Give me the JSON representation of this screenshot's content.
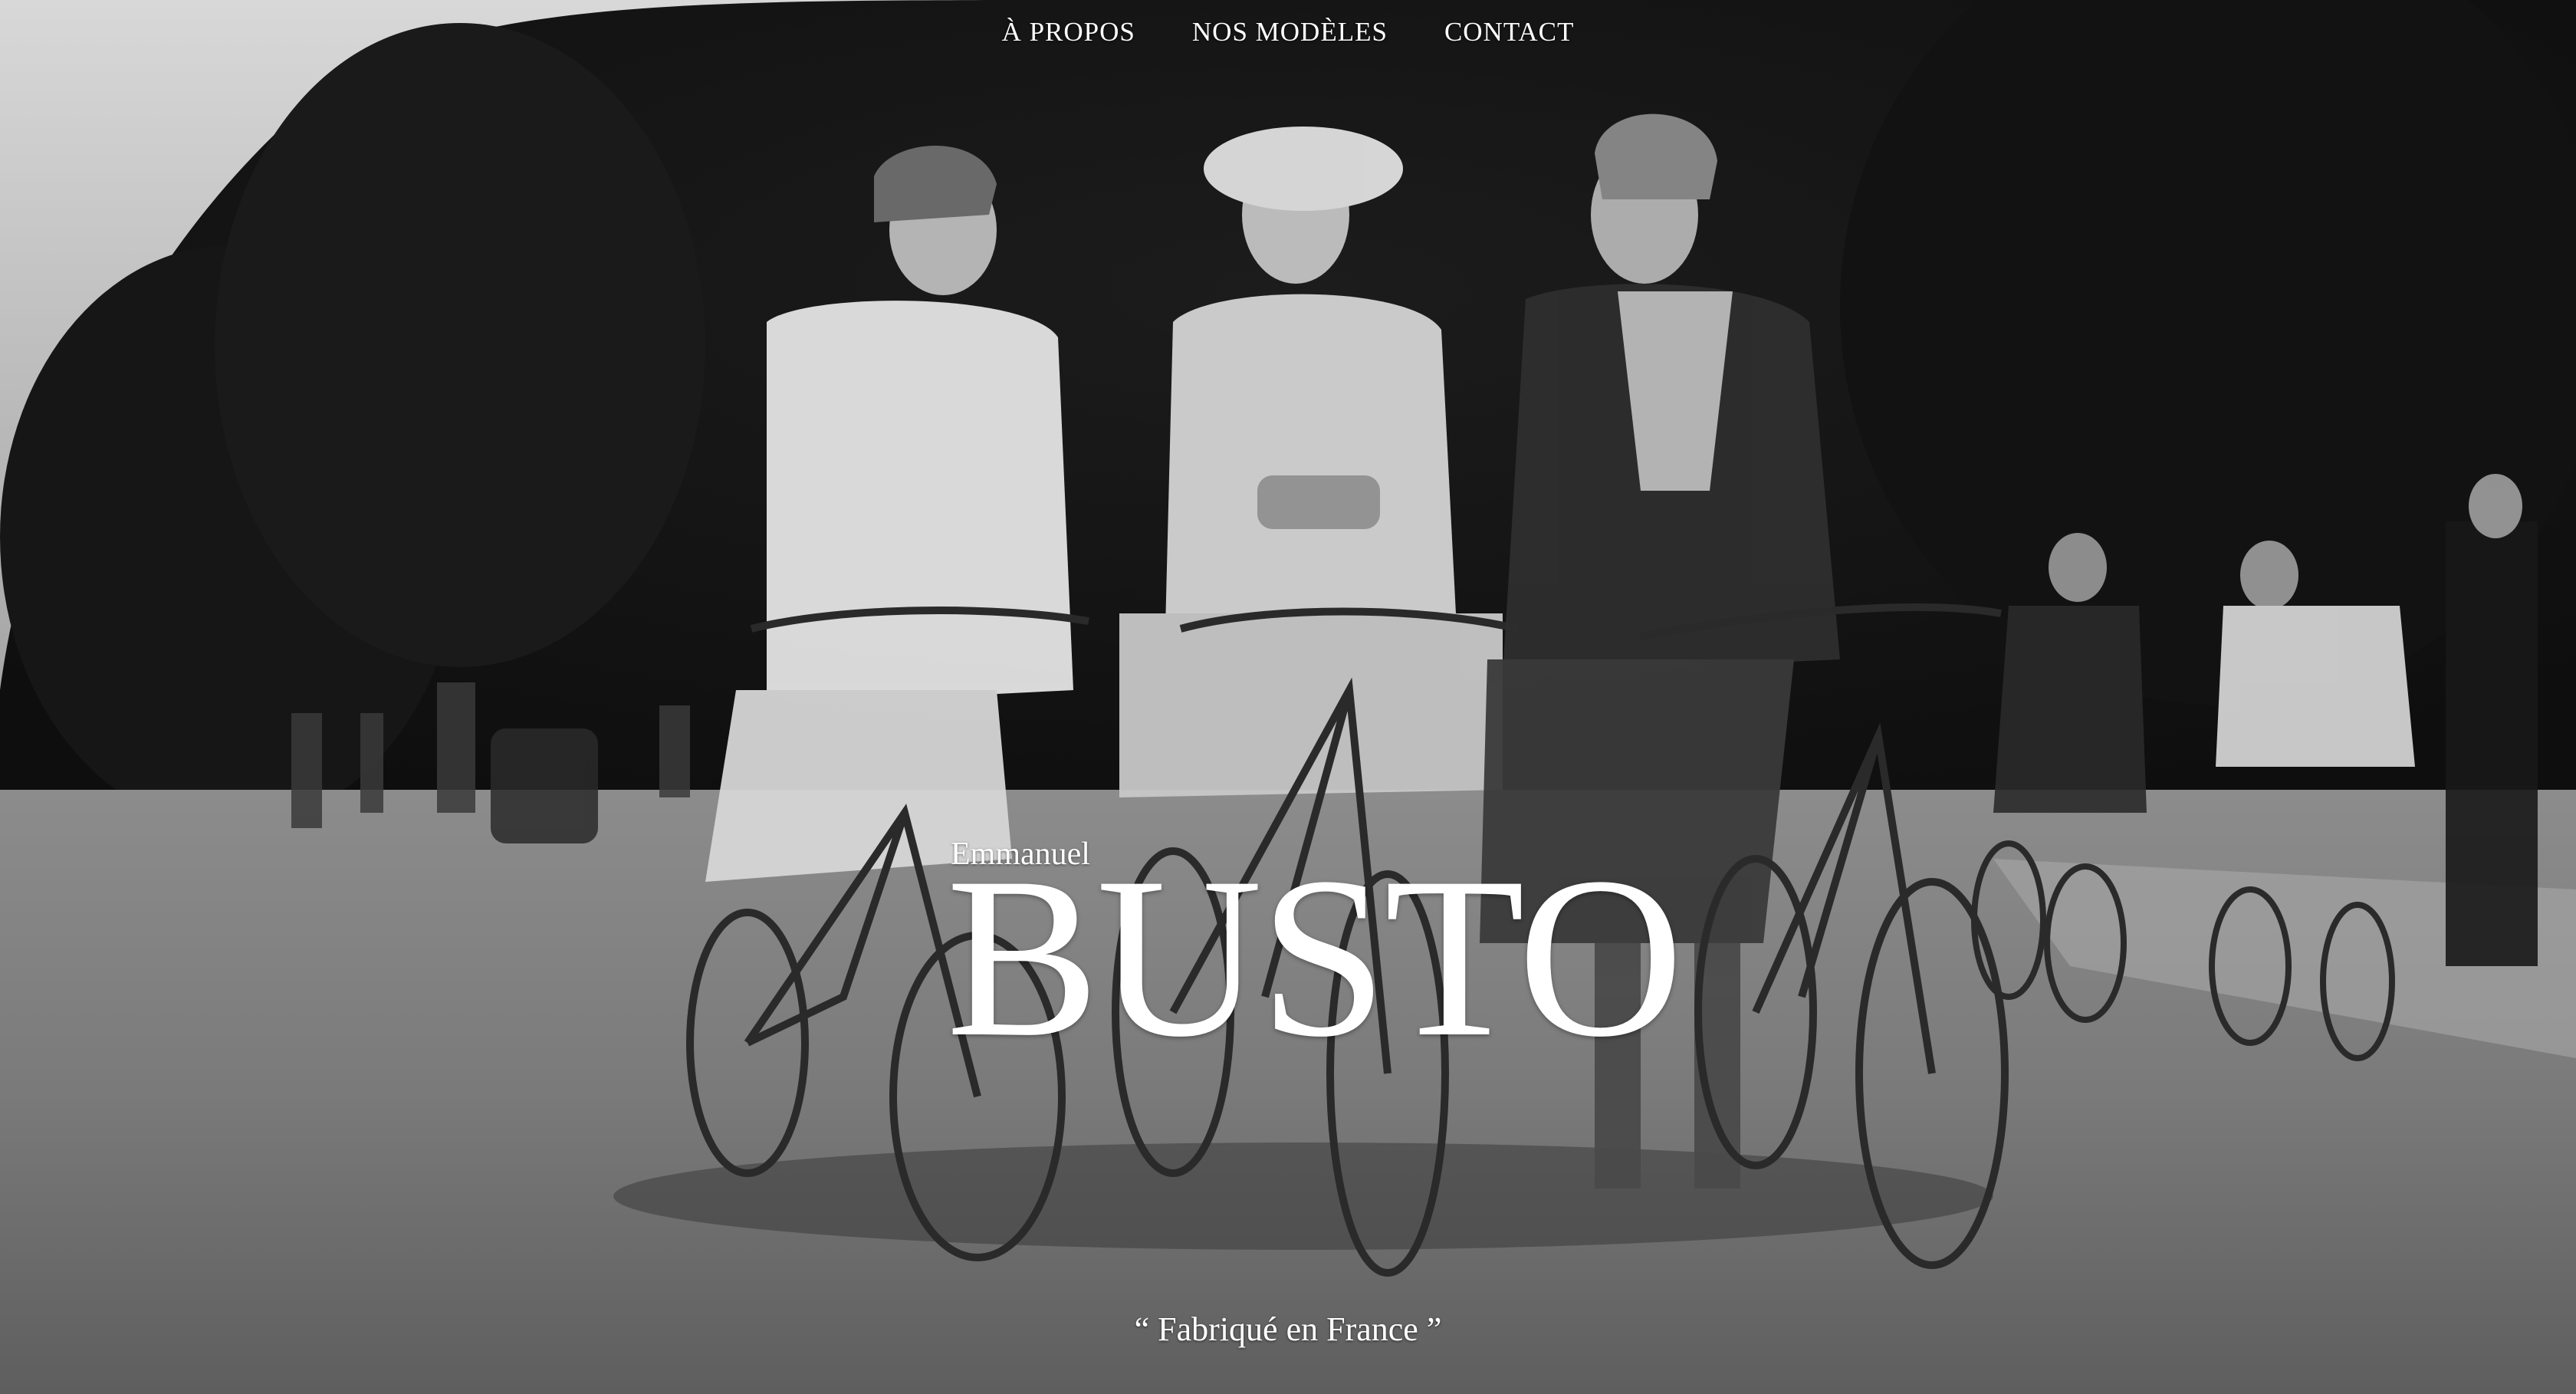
{
  "nav": {
    "items": [
      {
        "label": "À PROPOS"
      },
      {
        "label": "NOS MODÈLES"
      },
      {
        "label": "CONTACT"
      }
    ]
  },
  "brand": {
    "first_name": "Emmanuel",
    "last_name": "BUSTO"
  },
  "tagline": "“ Fabriqué en France ”",
  "photo": {
    "subject": "black-and-white vintage photo of three women walking bicycles on a tree-lined avenue"
  },
  "colors": {
    "text": "#ffffff"
  }
}
